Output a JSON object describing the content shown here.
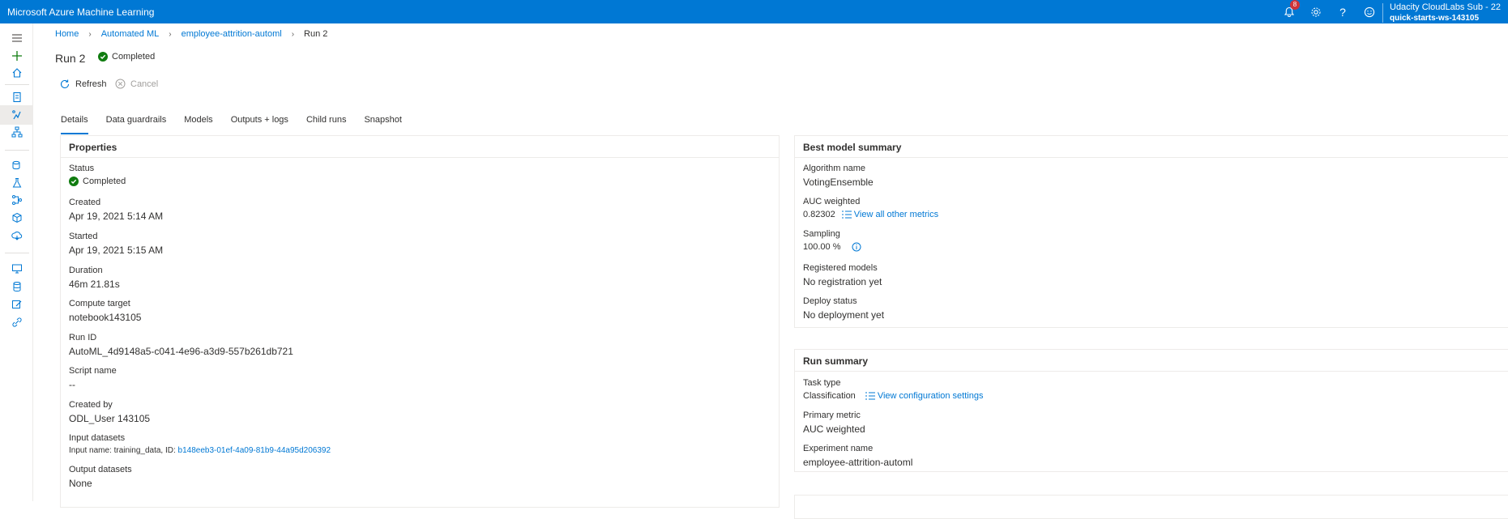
{
  "app": {
    "title": "Microsoft Azure Machine Learning"
  },
  "topbar": {
    "notification_count": "8",
    "account_name": "Udacity CloudLabs Sub - 22",
    "workspace": "quick-starts-ws-143105"
  },
  "breadcrumb": [
    "Home",
    "Automated ML",
    "employee-attrition-automl",
    "Run 2"
  ],
  "run": {
    "title": "Run 2",
    "status": "Completed"
  },
  "commands": {
    "refresh": "Refresh",
    "cancel": "Cancel"
  },
  "tabs": [
    "Details",
    "Data guardrails",
    "Models",
    "Outputs + logs",
    "Child runs",
    "Snapshot"
  ],
  "properties": {
    "title": "Properties",
    "status_label": "Status",
    "status_value": "Completed",
    "created_label": "Created",
    "created_value": "Apr 19, 2021 5:14 AM",
    "started_label": "Started",
    "started_value": "Apr 19, 2021 5:15 AM",
    "duration_label": "Duration",
    "duration_value": "46m 21.81s",
    "compute_label": "Compute target",
    "compute_value": "notebook143105",
    "runid_label": "Run ID",
    "runid_value": "AutoML_4d9148a5-c041-4e96-a3d9-557b261db721",
    "script_label": "Script name",
    "script_value": "--",
    "createdby_label": "Created by",
    "createdby_value": "ODL_User 143105",
    "input_label": "Input datasets",
    "input_prefix": "Input name: training_data, ID:",
    "input_id": "b148eeb3-01ef-4a09-81b9-44a95d206392",
    "output_label": "Output datasets",
    "output_value": "None"
  },
  "best_model": {
    "title": "Best model summary",
    "algo_label": "Algorithm name",
    "algo_value": "VotingEnsemble",
    "auc_label": "AUC weighted",
    "auc_value": "0.82302",
    "metrics_link": "View all other metrics",
    "sampling_label": "Sampling",
    "sampling_value": "100.00 %",
    "registered_label": "Registered models",
    "registered_value": "No registration yet",
    "deploy_label": "Deploy status",
    "deploy_value": "No deployment yet"
  },
  "run_summary": {
    "title": "Run summary",
    "task_label": "Task type",
    "task_value": "Classification",
    "config_link": "View configuration settings",
    "metric_label": "Primary metric",
    "metric_value": "AUC weighted",
    "experiment_label": "Experiment name",
    "experiment_value": "employee-attrition-automl"
  },
  "colors": {
    "brand": "#0078d4",
    "success": "#107c10",
    "badge": "#d13438"
  }
}
